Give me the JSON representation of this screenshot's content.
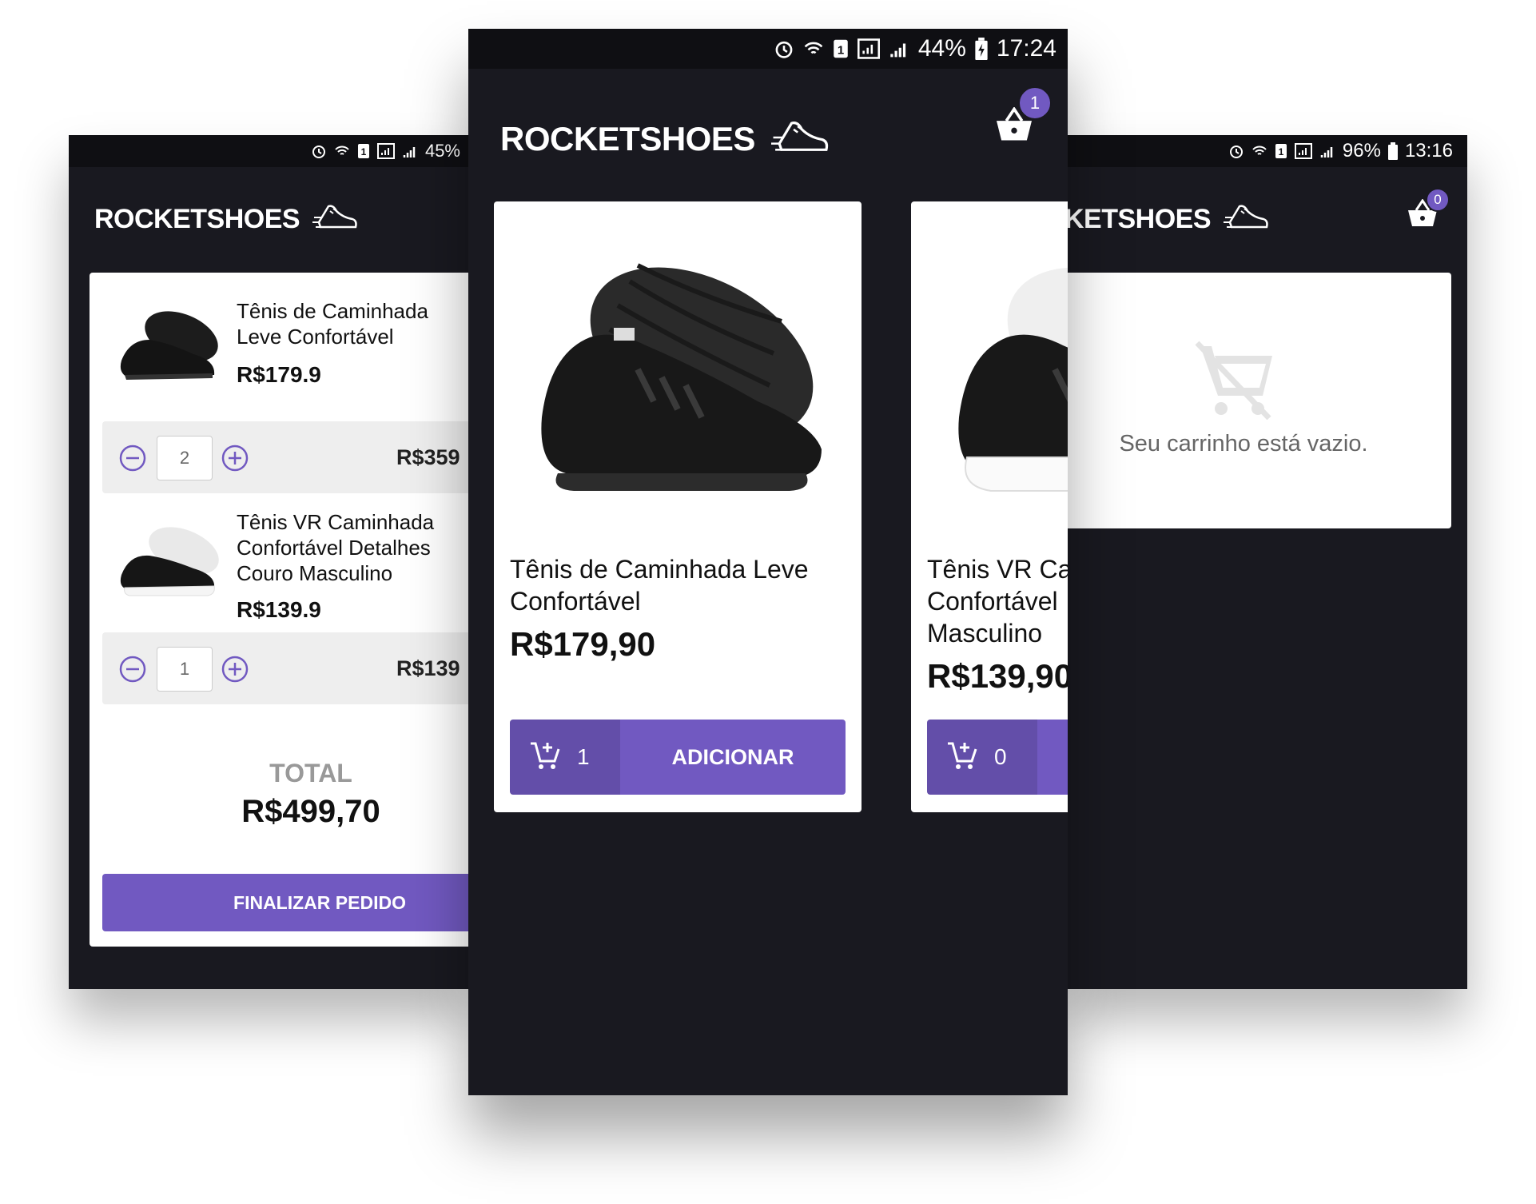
{
  "brand": {
    "name": "ROCKETSHOES",
    "accent": "#7159c1",
    "background": "#191920"
  },
  "left_phone": {
    "status": {
      "battery": "45%"
    },
    "cart_items": [
      {
        "title": "Tênis de Caminhada Leve Confortável",
        "price": "R$179.9",
        "quantity": "2",
        "subtotal": "R$359"
      },
      {
        "title": "Tênis VR Caminhada Confortável Detalhes Couro Masculino",
        "price": "R$139.9",
        "quantity": "1",
        "subtotal": "R$139"
      }
    ],
    "total_label": "TOTAL",
    "total_value": "R$499,70",
    "checkout_label": "FINALIZAR PEDIDO"
  },
  "center_phone": {
    "status": {
      "battery": "44%",
      "time": "17:24"
    },
    "cart_count": "1",
    "products": [
      {
        "title": "Tênis de Caminhada Leve Confortável",
        "price": "R$179,90",
        "in_cart": "1",
        "add_label": "ADICIONAR"
      },
      {
        "title": "Tênis VR Caminhada Confortável Detalhes Couro Masculino",
        "title_visible": "Tênis VR Ca\nConfortável\nMasculino",
        "price": "R$139,90",
        "in_cart": "0"
      }
    ]
  },
  "right_phone": {
    "status": {
      "battery": "96%",
      "time": "13:16"
    },
    "brand_partial": "KETSHOES",
    "cart_count": "0",
    "empty_message": "Seu carrinho está vazio.",
    "icons": [
      "remove-shopping-cart-icon"
    ]
  }
}
